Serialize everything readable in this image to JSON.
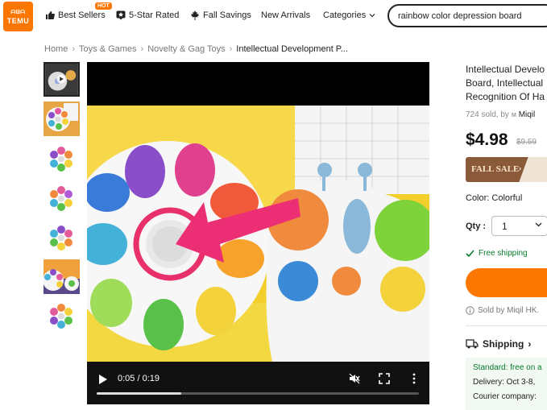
{
  "brand": {
    "logo_line1": "ᗩᗯᗩ",
    "logo_line2": "TEMU",
    "color": "#fb7701"
  },
  "nav": {
    "best_sellers": "Best Sellers",
    "hot_badge": "HOT",
    "five_star": "5-Star Rated",
    "fall_savings": "Fall Savings",
    "new_arrivals": "New Arrivals",
    "categories": "Categories"
  },
  "search": {
    "value": "rainbow color depression board"
  },
  "breadcrumb": [
    "Home",
    "Toys & Games",
    "Novelty & Gag Toys",
    "Intellectual Development P..."
  ],
  "video": {
    "timecode": "0:05 / 0:19",
    "progress": 0.263
  },
  "product": {
    "title_lines": [
      "Intellectual Develo",
      "Board, Intellectual",
      "Recognition Of Ha"
    ],
    "sold_text": "724 sold, by",
    "seller": "Miqil",
    "price": "$4.98",
    "old_price": "$9.59",
    "sale_label": "FALL SALE",
    "color_label": "Color: Colorful",
    "qty_label": "Qty :",
    "qty_value": "1",
    "free_shipping": "Free shipping",
    "sold_by": "Sold by Miqil HK.",
    "shipping_label": "Shipping",
    "standard": "Standard: free on a",
    "delivery": "Delivery: Oct 3-8,",
    "courier": "Courier company:"
  },
  "colors": {
    "accent": "#fb7701",
    "green": "#087a2a",
    "sale": "#8a5a3a"
  }
}
